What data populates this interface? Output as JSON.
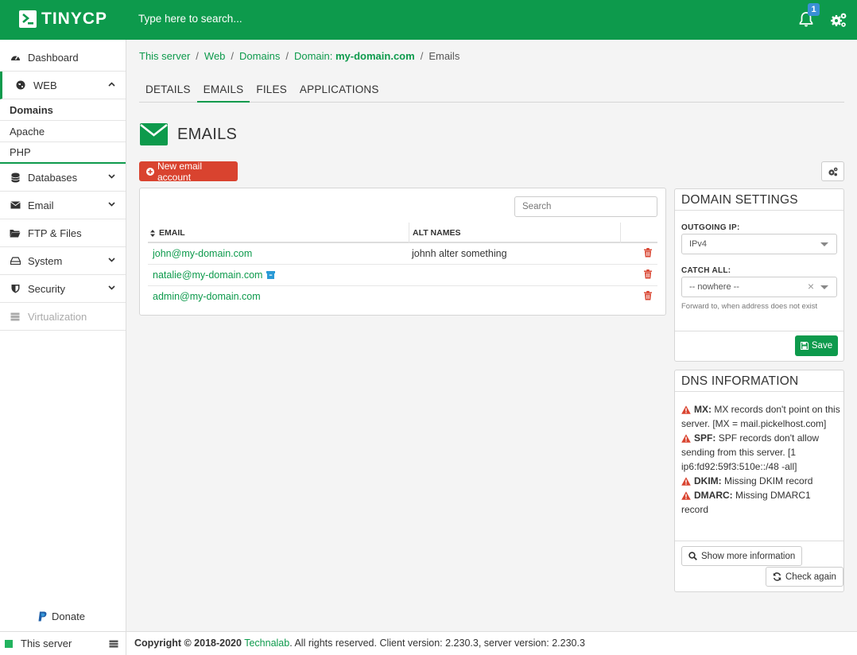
{
  "header": {
    "logo_text": "TINYCP",
    "search_placeholder": "Type here to search...",
    "notification_count": "1"
  },
  "sidebar": {
    "items": [
      {
        "label": "Dashboard",
        "icon": "dashboard-icon"
      },
      {
        "label": "WEB",
        "icon": "globe-icon"
      },
      {
        "label": "Domains"
      },
      {
        "label": "Apache"
      },
      {
        "label": "PHP"
      },
      {
        "label": "Databases",
        "icon": "database-icon"
      },
      {
        "label": "Email",
        "icon": "envelope-icon"
      },
      {
        "label": "FTP & Files",
        "icon": "folder-icon"
      },
      {
        "label": "System",
        "icon": "hdd-icon"
      },
      {
        "label": "Security",
        "icon": "shield-icon"
      },
      {
        "label": "Virtualization",
        "icon": "server-icon"
      }
    ],
    "donate": "Donate",
    "this_server": "This server"
  },
  "breadcrumb": {
    "items": [
      "This server",
      "Web",
      "Domains",
      "Domain: ",
      "my-domain.com",
      "Emails"
    ],
    "sep": "/"
  },
  "tabs": [
    "DETAILS",
    "EMAILS",
    "FILES",
    "APPLICATIONS"
  ],
  "page": {
    "title": "EMAILS",
    "new_button": "New email account"
  },
  "table": {
    "search_placeholder": "Search",
    "columns": [
      "EMAIL",
      "ALT NAMES"
    ],
    "rows": [
      {
        "email": "john@my-domain.com",
        "alt": "johnh  alter  something"
      },
      {
        "email": "natalie@my-domain.com",
        "alt": ""
      },
      {
        "email": "admin@my-domain.com",
        "alt": ""
      }
    ]
  },
  "domain_settings": {
    "title": "DOMAIN SETTINGS",
    "outgoing_ip_label": "OUTGOING IP:",
    "outgoing_ip_value": "IPv4",
    "catch_all_label": "CATCH ALL:",
    "catch_all_value": "-- nowhere --",
    "catch_all_hint": "Forward to, when address does not exist",
    "save_label": "Save"
  },
  "dns": {
    "title": "DNS INFORMATION",
    "entries": [
      {
        "key": "MX:",
        "text": "MX records don't point on this server. [MX = mail.pickelhost.com]"
      },
      {
        "key": "SPF:",
        "text": "SPF records don't allow sending from this server. [1 ip6:fd92:59f3:510e::/48 -all]"
      },
      {
        "key": "DKIM:",
        "text": "Missing DKIM record"
      },
      {
        "key": "DMARC:",
        "text": "Missing DMARC1 record"
      }
    ],
    "show_more": "Show more information",
    "check_again": "Check again"
  },
  "footer": {
    "copyright": "Copyright © 2018-2020",
    "company": "Technalab",
    "rest": ". All rights reserved. Client version: 2.230.3, server version: 2.230.3"
  },
  "colors": {
    "brand": "#0d9a4c",
    "danger": "#d9432f",
    "warning": "#d9432f"
  }
}
